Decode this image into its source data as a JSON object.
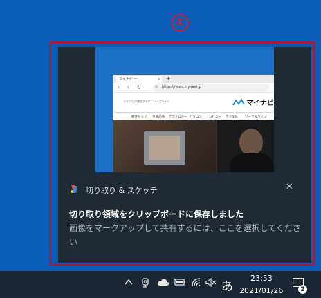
{
  "annotation": {
    "marker": "①"
  },
  "toast": {
    "app_name": "切り取り & スケッチ",
    "close_glyph": "✕",
    "title": "切り取り領域をクリップボードに保存しました",
    "body": "画像をマークアップして共有するには、ここを選択してください"
  },
  "preview": {
    "tab_label": "マイナビ ー…",
    "tab_close": "×",
    "tab_plus": "+",
    "url": "https://news.mynavi.jp",
    "tagline": "マイナビが運営するITニュースサイト",
    "logo": "マイナビ",
    "nav_items": [
      "総合トップ",
      "注目記事",
      "テクノロジー",
      "パソコン",
      "レビュー",
      "デジタル",
      "ワーク＆ライフ"
    ]
  },
  "taskbar": {
    "chevron": "^",
    "ime": "あ",
    "time": "23:53",
    "date": "2021/01/26",
    "notification_count": "2"
  },
  "colors": {
    "desktop": "#0b5cb6",
    "highlight": "#a01d3d",
    "toast_bg": "#1f2a35",
    "taskbar_bg": "#1b2633"
  }
}
